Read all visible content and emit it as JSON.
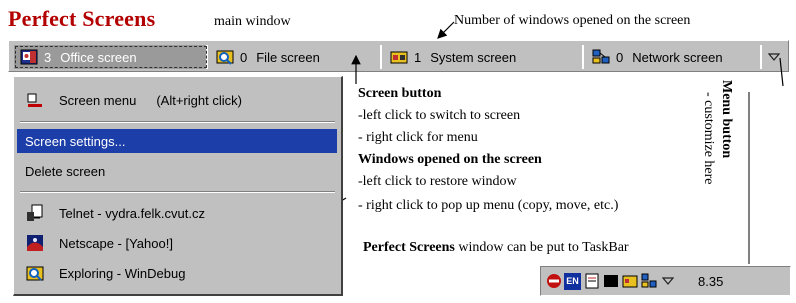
{
  "caption": {
    "title": "Perfect Screens",
    "subtitle": "main window",
    "count_note": "Number of windows opened on the screen"
  },
  "screen_bar": {
    "tabs": [
      {
        "count": "3",
        "label": "Office screen",
        "icon": "office-screen-icon",
        "active": true
      },
      {
        "count": "0",
        "label": "File screen",
        "icon": "file-screen-icon",
        "active": false
      },
      {
        "count": "1",
        "label": "System screen",
        "icon": "system-screen-icon",
        "active": false
      },
      {
        "count": "0",
        "label": "Network screen",
        "icon": "network-screen-icon",
        "active": false
      }
    ],
    "menu_button_icon": "triangle-down-icon"
  },
  "popup_menu": {
    "items": [
      {
        "label": "Screen menu",
        "shortcut": "(Alt+right click)",
        "icon": "screen-menu-icon"
      },
      {
        "label": "Screen settings...",
        "selected": true
      },
      {
        "label": "Delete screen"
      },
      {
        "label": "Telnet - vydra.felk.cvut.cz",
        "icon": "telnet-icon"
      },
      {
        "label": "Netscape - [Yahoo!]",
        "icon": "netscape-icon"
      },
      {
        "label": "Exploring - WinDebug",
        "icon": "explorer-icon"
      }
    ]
  },
  "annotations": {
    "screen_button_title": "Screen button",
    "screen_button_line1": "-left click to switch to screen",
    "screen_button_line2": "- right click for menu",
    "windows_title": "Windows opened on the screen",
    "windows_line1": "-left click to restore window",
    "windows_line2": "- right click to pop up menu (copy, move, etc.)",
    "taskbar_bold": "Perfect Screens",
    "taskbar_rest": " window can be put to TaskBar",
    "menu_button_title": "Menu button",
    "menu_button_sub": "- customize here"
  },
  "tray": {
    "icons": [
      "no-entry-icon",
      "en-language-icon",
      "document-icon",
      "black-window-icon",
      "yellow-folder-icon",
      "network-icon",
      "triangle-down-icon"
    ],
    "en_label": "EN",
    "clock": "8.35"
  },
  "colors": {
    "title_red": "#b30000",
    "selection_blue": "#1c3ea8",
    "face_gray": "#c0c0c0"
  }
}
